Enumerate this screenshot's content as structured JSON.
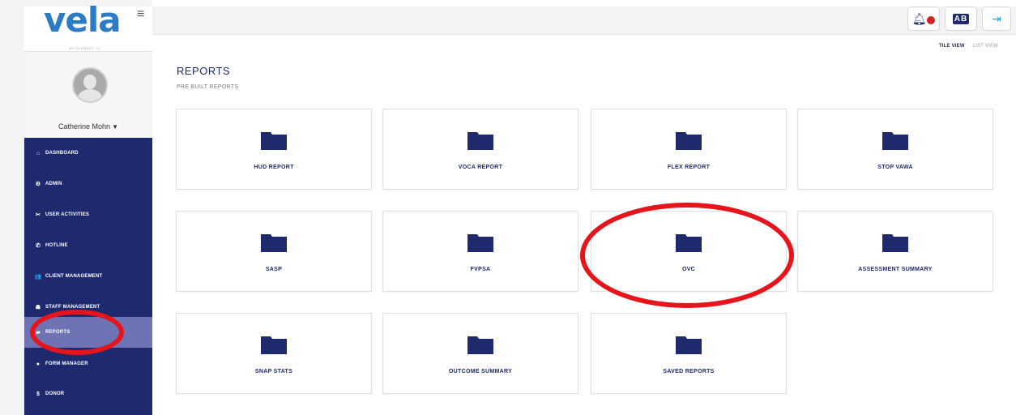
{
  "app": {
    "logo": "vela",
    "logo_sub": "BY ELEMENT 74"
  },
  "user": {
    "name": "Catherine Mohn"
  },
  "sidebar": {
    "items": [
      {
        "label": "DASHBOARD",
        "icon": "home-icon",
        "glyph": "⌂"
      },
      {
        "label": "ADMIN",
        "icon": "gears-icon",
        "glyph": "⚙"
      },
      {
        "label": "USER ACTIVITIES",
        "icon": "user-activity-icon",
        "glyph": "✂"
      },
      {
        "label": "HOTLINE",
        "icon": "phone-icon",
        "glyph": "✆"
      },
      {
        "label": "CLIENT MANAGEMENT",
        "icon": "users-icon",
        "glyph": "👥"
      },
      {
        "label": "STAFF MANAGEMENT",
        "icon": "staff-icon",
        "glyph": "☗"
      },
      {
        "label": "REPORTS",
        "icon": "reports-icon",
        "glyph": "▰",
        "active": true
      },
      {
        "label": "FORM MANAGER",
        "icon": "form-icon",
        "glyph": "●"
      },
      {
        "label": "DONOR",
        "icon": "dollar-icon",
        "glyph": "$"
      }
    ]
  },
  "toolbar": {
    "notification_icon": "bell-icon",
    "translate_icon": "language-icon",
    "translate_text": "AB",
    "logout_icon": "sign-out-icon"
  },
  "view_toggle": {
    "tile": "TILE VIEW",
    "list": "LIST VIEW"
  },
  "main": {
    "title": "REPORTS",
    "subtitle": "PRE BUILT REPORTS",
    "tiles": [
      {
        "label": "HUD REPORT"
      },
      {
        "label": "VOCA REPORT"
      },
      {
        "label": "FLEX REPORT"
      },
      {
        "label": "STOP VAWA"
      },
      {
        "label": "SASP"
      },
      {
        "label": "FVPSA"
      },
      {
        "label": "OVC"
      },
      {
        "label": "ASSESSMENT SUMMARY"
      },
      {
        "label": "SNAP STATS"
      },
      {
        "label": "OUTCOME SUMMARY"
      },
      {
        "label": "SAVED REPORTS"
      }
    ]
  },
  "colors": {
    "navy": "#1f2a6e",
    "active": "#6d73b3",
    "annotation": "#e6141b",
    "logo": "#2c7bc4"
  }
}
